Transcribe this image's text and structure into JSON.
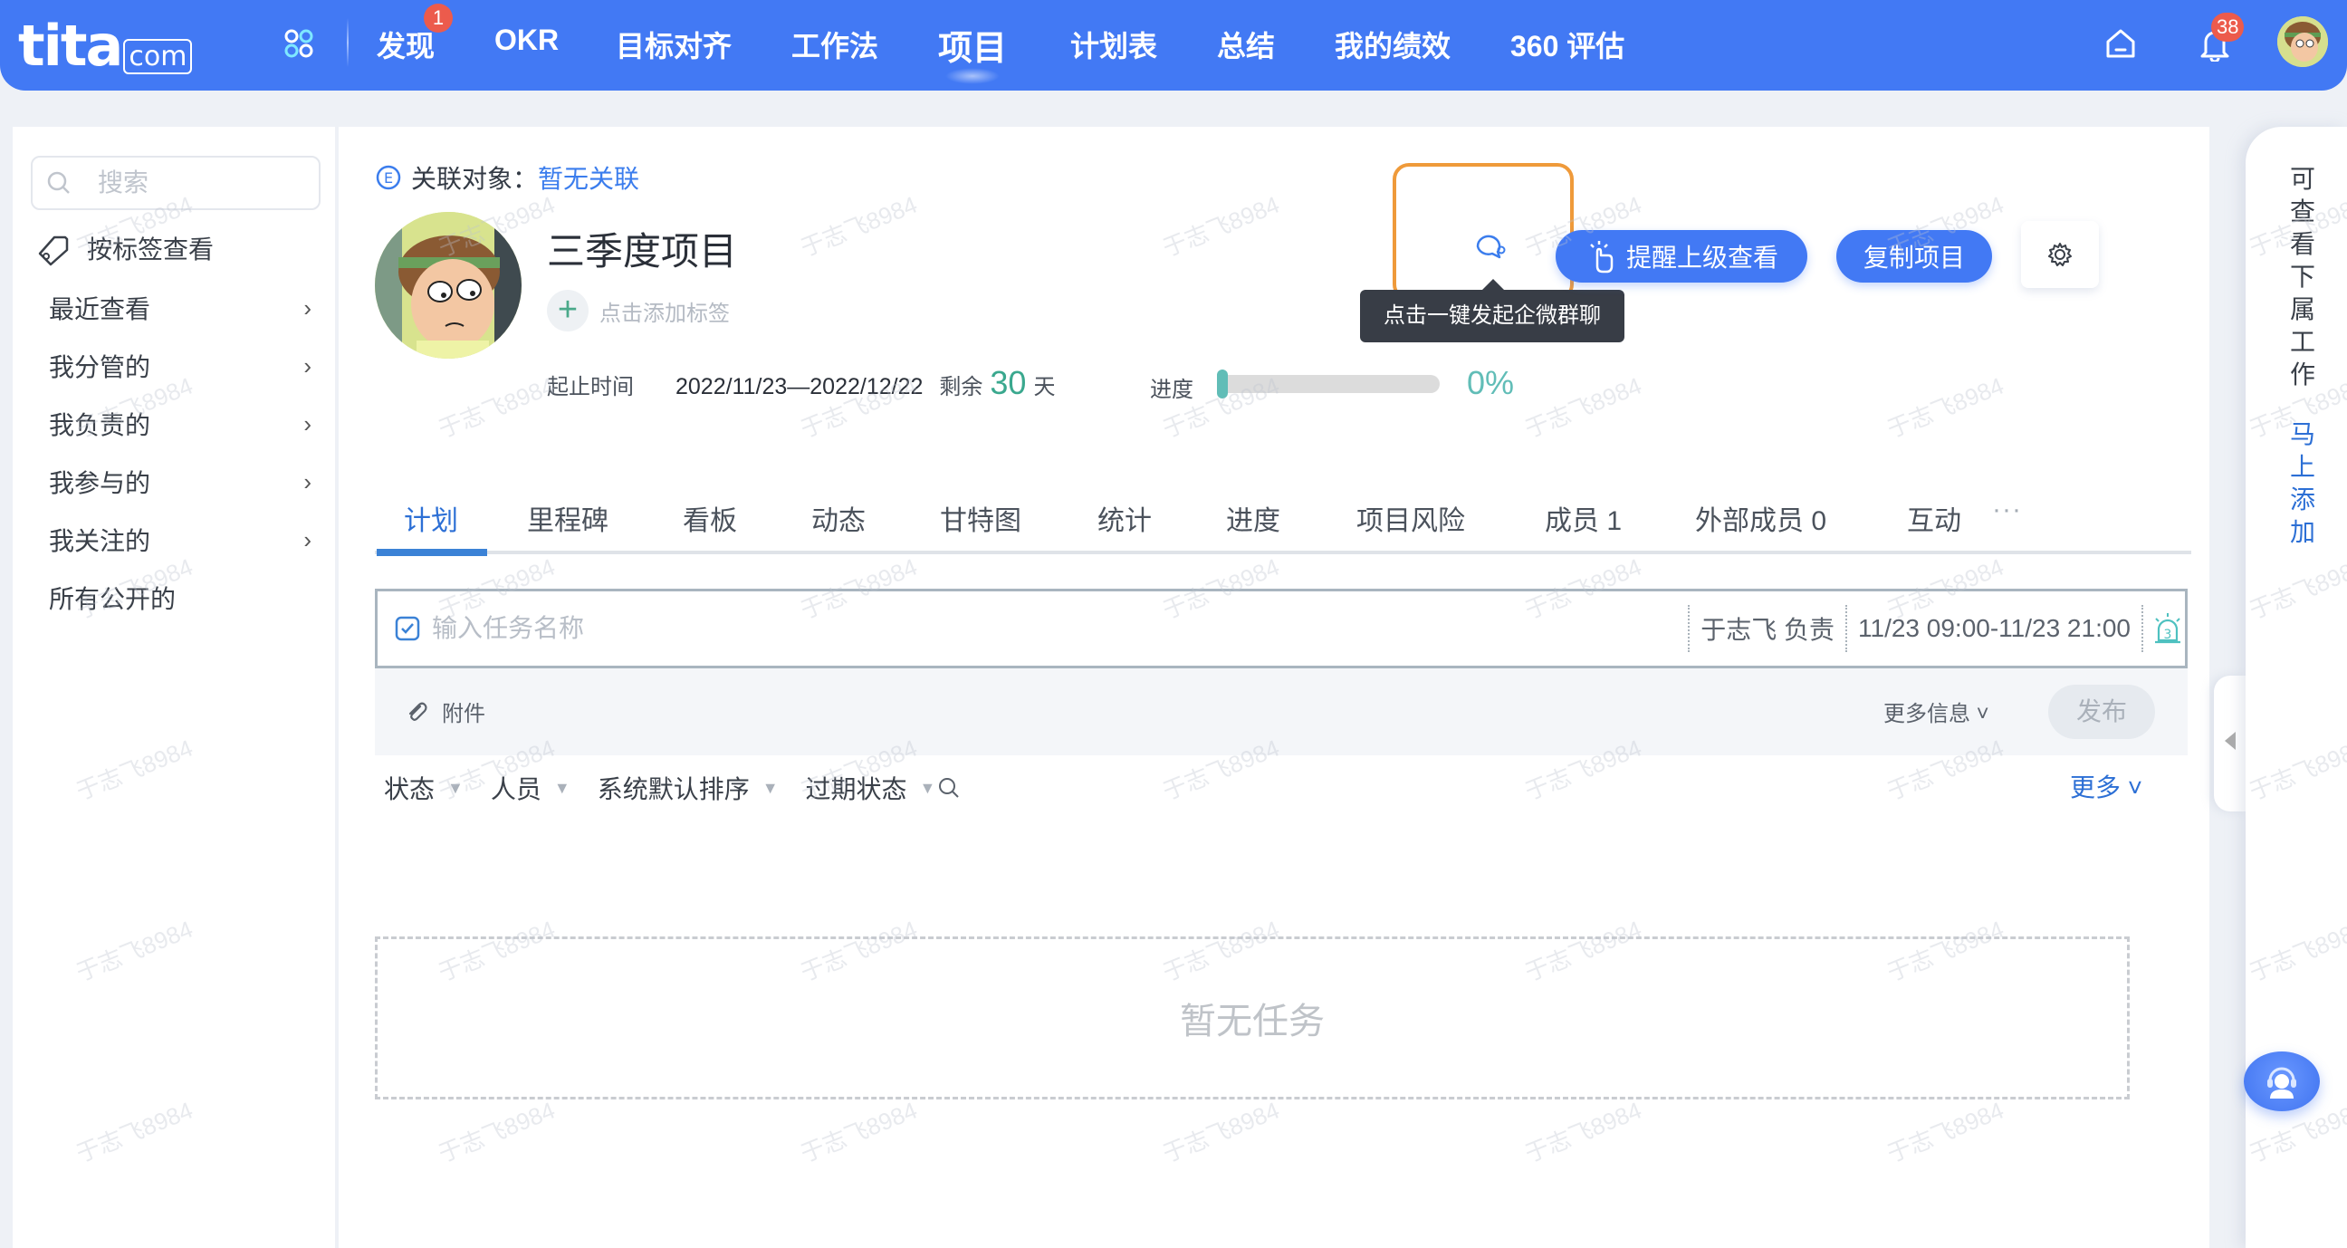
{
  "header": {
    "logo_main": "tita",
    "logo_suffix": "com",
    "nav": [
      {
        "label": "发现",
        "badge": "1"
      },
      {
        "label": "OKR"
      },
      {
        "label": "目标对齐"
      },
      {
        "label": "工作法"
      },
      {
        "label": "项目",
        "active": true
      },
      {
        "label": "计划表"
      },
      {
        "label": "总结"
      },
      {
        "label": "我的绩效"
      },
      {
        "label": "360 评估"
      }
    ],
    "notification_count": "38",
    "icons": [
      "apps-icon",
      "home-icon",
      "bell-icon",
      "user-avatar"
    ]
  },
  "sidebar": {
    "search_placeholder": "搜索",
    "tag_view": "按标签查看",
    "items": [
      {
        "label": "最近查看",
        "chevron": "›"
      },
      {
        "label": "我分管的",
        "chevron": "›"
      },
      {
        "label": "我负责的",
        "chevron": "›"
      },
      {
        "label": "我参与的",
        "chevron": "›"
      },
      {
        "label": "我关注的",
        "chevron": "›"
      },
      {
        "label": "所有公开的"
      }
    ]
  },
  "project": {
    "related_label": "关联对象：",
    "related_value": "暂无关联",
    "title": "三季度项目",
    "add_tag": "点击添加标签",
    "add_tag_icon": "+",
    "date_label": "起止时间",
    "date_range": "2022/11/23—2022/12/22",
    "remaining_label": "剩余",
    "remaining_days": "30",
    "remaining_unit": "天",
    "progress_label": "进度",
    "progress_percent": 0,
    "progress_text": "0%",
    "chat_tooltip": "点击一键发起企微群聊",
    "remind_button": "提醒上级查看",
    "copy_button": "复制项目"
  },
  "tabs": [
    {
      "label": "计划",
      "active": true
    },
    {
      "label": "里程碑"
    },
    {
      "label": "看板"
    },
    {
      "label": "动态"
    },
    {
      "label": "甘特图"
    },
    {
      "label": "统计"
    },
    {
      "label": "进度"
    },
    {
      "label": "项目风险"
    },
    {
      "label": "成员 1"
    },
    {
      "label": "外部成员 0"
    },
    {
      "label": "互动"
    }
  ],
  "tabs_more": "···",
  "task_input": {
    "placeholder": "输入任务名称",
    "owner": "于志飞 负责",
    "time": "11/23 09:00-11/23 21:00",
    "reminder_count": "3",
    "attachment": "附件",
    "more_info": "更多信息 ˅",
    "publish": "发布"
  },
  "filters": {
    "items": [
      "状态",
      "人员",
      "系统默认排序",
      "过期状态"
    ],
    "triangle": "▼",
    "more": "更多 ˅"
  },
  "empty_text": "暂无任务",
  "right_panel": {
    "text": "可查看下属工作",
    "link": "马上添加"
  },
  "watermark": "于志飞8984",
  "colors": {
    "brand": "#4279f4",
    "link": "#2c6fd5",
    "accent_green": "#3aa88e",
    "progress": "#61bdb7",
    "badge": "#ec5b4c",
    "highlight": "#ef9a3a"
  }
}
